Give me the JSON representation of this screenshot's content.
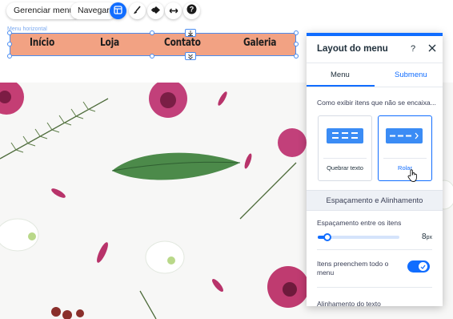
{
  "toolbar": {
    "manage_menu_label": "Gerenciar menu",
    "navigate_label": "Navegar",
    "icons": [
      "layout-icon",
      "paint-brush-icon",
      "animation-icon",
      "stretch-icon",
      "help-icon"
    ]
  },
  "menu_element": {
    "tag": "Menu horizontal",
    "items": [
      "Início",
      "Loja",
      "Contato",
      "Galeria"
    ],
    "background_color": "#f2a283"
  },
  "panel": {
    "title": "Layout do menu",
    "help_label": "?",
    "tabs": [
      {
        "label": "Menu",
        "active": true
      },
      {
        "label": "Submenu",
        "active": false
      }
    ],
    "overflow_question": "Como exibir itens que não se encaixa...",
    "overflow_options": [
      {
        "label": "Quebrar texto",
        "selected": false
      },
      {
        "label": "Rolar",
        "selected": true
      }
    ],
    "spacing_section_title": "Espaçamento e Alinhamento",
    "spacing_label": "Espaçamento entre os itens",
    "spacing_value": "8",
    "spacing_unit": "px",
    "spacing_fraction": 0.12,
    "fill_menu_label": "Itens preenchem todo o menu",
    "fill_menu_enabled": true,
    "text_alignment_label": "Alinhamento do texto",
    "accent_color": "#116dff"
  }
}
